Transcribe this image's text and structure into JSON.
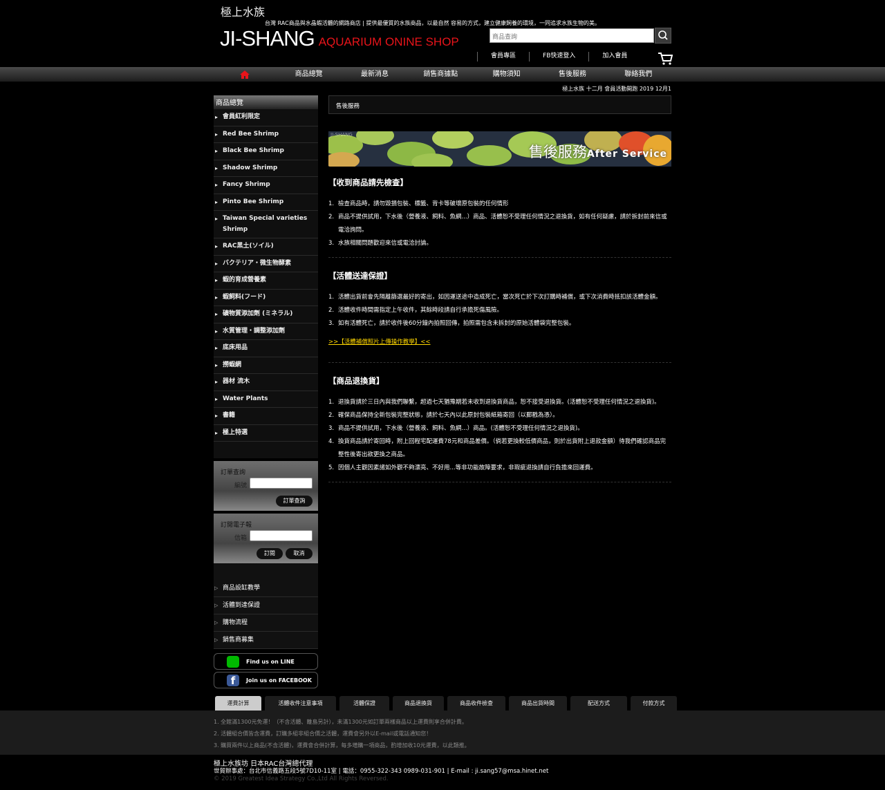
{
  "header": {
    "site_title": "極上水族",
    "tagline": "台灣 RAC商品與水晶蝦活體的網路商店 | 提供最優質的水族商品，以最自然 容易的方式，建立健康飼養的環境，一同追求水族生物的美。",
    "logo_main": "JI-SHANG",
    "logo_sub": "AQUARIUM  ONINE SHOP",
    "search_placeholder": "商品查詢",
    "links": [
      "會員專區",
      "FB快速登入",
      "加入會員"
    ]
  },
  "nav": {
    "items": [
      "商品總覽",
      "最新消息",
      "銷售商據點",
      "購物須知",
      "售後服務",
      "聯絡我們"
    ]
  },
  "marquee": "極上水族 十二月 會員活動開跑 2019 12月1",
  "sidebar": {
    "title": "商品總覽",
    "items": [
      "會員紅利限定",
      "Red Bee Shrimp",
      "Black Bee Shrimp",
      "Shadow Shrimp",
      "Fancy Shrimp",
      "Pinto Bee Shrimp",
      "Taiwan Special varieties Shrimp",
      "RAC黑土(ソイル)",
      "バクテリア・微生物酵素",
      "蝦的育成營養素",
      "蝦飼料(フード)",
      "礦物質添加劑 (ミネラル)",
      "水質管理・調整添加劑",
      "底床用品",
      "撈蝦網",
      "器材 流木",
      "Water Plants",
      "書籍",
      "極上特選"
    ],
    "order_query": {
      "title": "訂單查詢",
      "label": "編號",
      "button": "訂單查詢"
    },
    "newsletter": {
      "title": "訂閱電子報",
      "label": "信箱",
      "subscribe": "訂閱",
      "cancel": "取消"
    },
    "links": [
      "商品設缸教學",
      "活體到達保證",
      "購物流程",
      "銷售商募集"
    ],
    "social": [
      {
        "label": "Find us on LINE",
        "color": "#00b900"
      },
      {
        "label": "Join us on FACEBOOK",
        "color": "#3b5998"
      }
    ]
  },
  "breadcrumb": "售後服務",
  "banner": {
    "watermark": "JI-SHANG",
    "title": "售後服務",
    "subtitle": "After Service"
  },
  "sections": [
    {
      "title": "【收到商品請先檢查】",
      "items": [
        "檢查商品時，請勿毀損包裝、標籤、背卡等破壞原包裝的任何情形",
        "商品不提供試用，下水後（營養液、飼料、魚網...）商品、活體恕不受理任何情況之退換貨，如有任何疑慮，請於拆封前來信或電洽詢問。",
        "水族相關問題歡迎來信或電洽討論。"
      ]
    },
    {
      "title": "【活體送達保證】",
      "items": [
        "活體出貨前會先隔離篩選最好的寄出，如因運送途中造成死亡，當次死亡於下次訂購時補償，或下次消費時抵扣該活體金額。",
        "活體收件時間需指定上午收件，其餘時段請自行承擔死傷風險。",
        "如有活體死亡，請於收件後60分鐘內拍照回傳，拍照需包含未拆封的原始活體袋完整包裝。"
      ],
      "link": ">>【活體補償照片上傳操作教學】<<"
    },
    {
      "title": "【商品退換貨】",
      "items": [
        "退換貨請於三日內與我們聯繫，超過七天猶豫期若未收到退換貨商品，恕不接受退換貨。(活體恕不受理任何情況之退換貨)。",
        "確保商品保持全新包裝完整狀態，請於七天內以此原封包裝紙箱寄回（以郵戳為憑）。",
        "商品不提供試用，下水後（營養液、飼料、魚網...）商品。(活體恕不受理任何情況之退換貨)。",
        "換貨商品請於寄回時，附上回程宅配運費78元和商品差價。（倘若更換較低價商品，則於出貨附上退款金額）待我們確認商品完整性後寄出欲更換之商品。",
        "因個人主觀因素諸如外觀不夠漂亮、不好用...等非功能故障要求，非瑕疵退換請自行負擔來回運費。"
      ]
    }
  ],
  "tabs": {
    "items": [
      "運費計算",
      "活體收件注意事項",
      "活體保證",
      "商品退換貨",
      "商品收件檢查",
      "商品出貨時間",
      "配送方式",
      "付款方式"
    ],
    "active": 0,
    "panel": [
      "1. 全館滿1300元免運！（不含活體、離島另計），未滿1300元如訂單兩樣商品以上運費則享合併計費。",
      "2. 活體組合價皆含運費，訂購多組非組合價之活體，運費會另外以E-mail或電話通知您！",
      "3. 購買兩件以上商品(不含活體)，運費會合併計算，每多増購一項商品，酌增加收10元運費，以此類推。"
    ]
  },
  "footer": {
    "line1": "極上水族坊 日本RAC台灣總代理",
    "line2": "世貿辦事處：台北市信義路五段5號7D10-11室 | 電話：0955-322-343 0989-031-901 | E-mail : ji.sang57@msa.hinet.net",
    "copyright": "© 2019 Greatest Idea Strategy Co.,Ltd All Rights Reversed."
  },
  "colors": {
    "accent_red": "#e8141a",
    "link_yellow": "#ffd700"
  }
}
